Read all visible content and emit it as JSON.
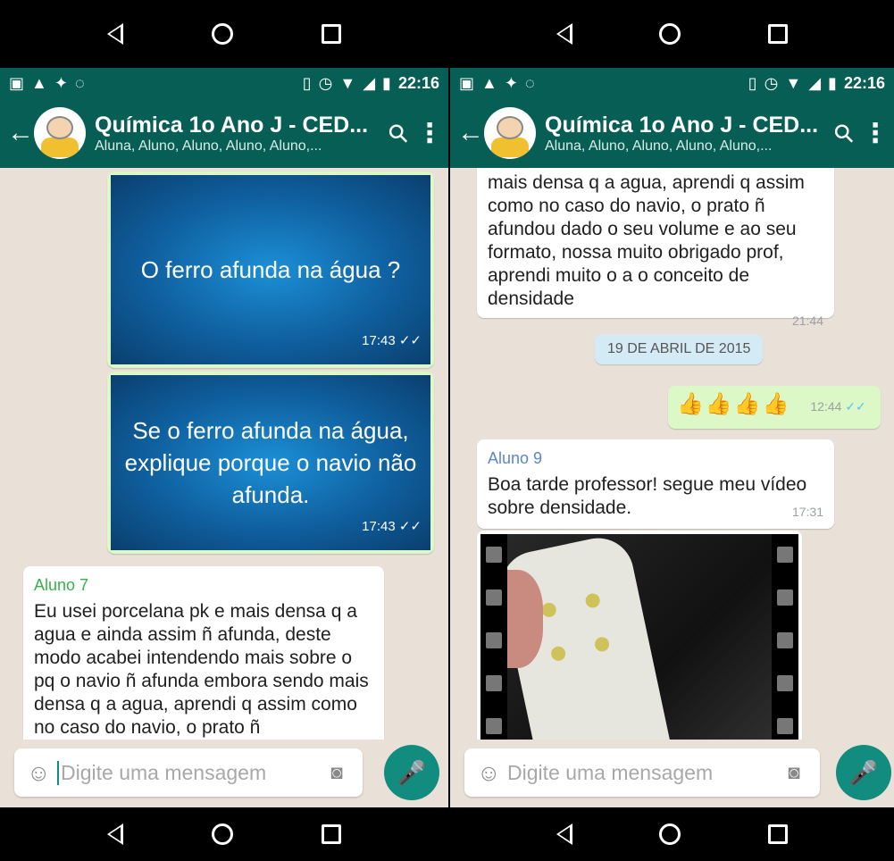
{
  "left": {
    "status": {
      "time": "22:16"
    },
    "header": {
      "title": "Química 1o Ano J - CED...",
      "subtitle": "Aluna, Aluno, Aluno, Aluno, Aluno,..."
    },
    "messages": {
      "slide1_text": "O ferro afunda na água ?",
      "slide1_time": "17:43",
      "slide2_text": "Se o ferro afunda na água, explique porque o navio não afunda.",
      "slide2_time": "17:43",
      "msg_sender": "Aluno 7",
      "msg_text": "Eu usei porcelana pk e mais densa q a agua e ainda assim ñ afunda, deste modo acabei intendendo mais sobre o pq o navio ñ afunda embora sendo mais densa q a agua, aprendi q assim como no caso do navio, o prato ñ"
    },
    "input": {
      "placeholder": "Digite uma mensagem"
    }
  },
  "right": {
    "status": {
      "time": "22:16"
    },
    "header": {
      "title": "Química 1o Ano J - CED...",
      "subtitle": "Aluna, Aluno, Aluno, Aluno, Aluno,..."
    },
    "messages": {
      "cont_text": "mais densa q a agua, aprendi q assim como no caso do navio, o prato ñ afundou dado o seu volume e ao seu formato, nossa muito obrigado prof, aprendi muito o a o conceito de densidade",
      "cont_time": "21:44",
      "date_divider": "19 DE ABRIL DE 2015",
      "thumbs_time": "12:44",
      "thumbs_text": "👍👍👍👍",
      "msg_sender": "Aluno 9",
      "msg_text": "Boa tarde professor! segue meu vídeo sobre densidade.",
      "msg_time": "17:31"
    },
    "input": {
      "placeholder": "Digite uma mensagem"
    }
  },
  "colors": {
    "header": "#075e54",
    "chat_bg": "#e9e1d7",
    "outgoing": "#dcf8c6",
    "mic": "#128c7e",
    "sender_green": "#35b34a",
    "sender_blue": "#5b86c9",
    "read_ticks": "#4fc3f7"
  },
  "icons": [
    "back-arrow-icon",
    "paperclip-icon",
    "more-vert-icon",
    "emoji-icon",
    "camera-icon",
    "mic-icon",
    "nav-back-icon",
    "nav-home-icon",
    "nav-recent-icon"
  ]
}
